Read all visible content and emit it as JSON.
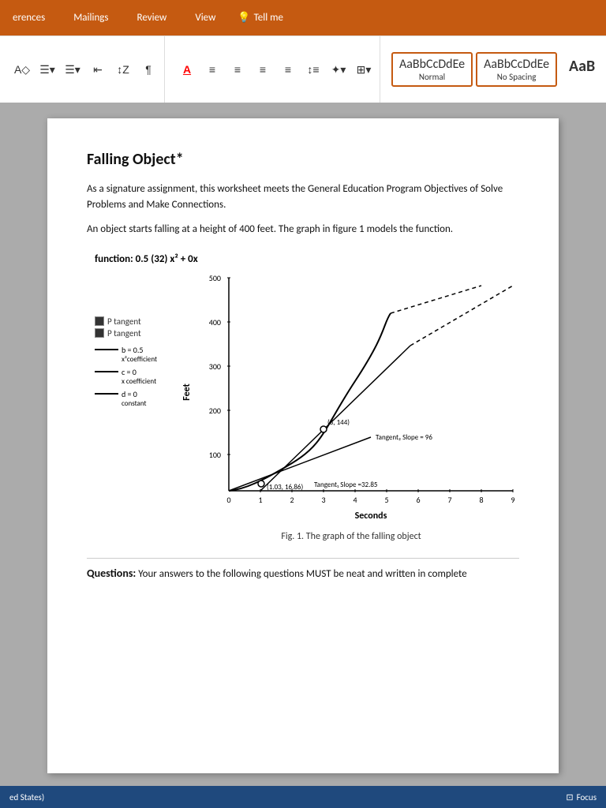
{
  "ribbon": {
    "tabs": [
      "erences",
      "Mailings",
      "Review",
      "View"
    ],
    "tell_me_label": "Tell me",
    "style_normal_label": "Normal",
    "style_nospacing_label": "No Spacing",
    "style_heading_label": "AaB",
    "style_preview_normal": "AaBbCcDdEe",
    "style_preview_nospacing": "AaBbCcDdEe"
  },
  "document": {
    "title": "Falling Object*",
    "intro_para": "As a signature assignment, this worksheet meets the General Education Program Objectives of Solve Problems and Make Connections.",
    "desc_para": "An object starts falling at a height of 400 feet. The graph in figure 1 models the function.",
    "function_label": "function: 0.5 (32) x² + 0x",
    "graph_y_label": "Feet",
    "graph_x_label": "Seconds",
    "graph_y_values": [
      "500",
      "400",
      "300",
      "200",
      "100"
    ],
    "graph_x_values": [
      "0",
      "1",
      "2",
      "3",
      "4",
      "5",
      "6",
      "7",
      "8",
      "9"
    ],
    "tangent1_label": "Tangent₁ Slope =32.85",
    "tangent2_label": "Tangent₂ Slope = 96",
    "point1_label": "(1.03, 16.86)",
    "point2_label": "(3, 144)",
    "b_coef": "b = 0.5",
    "b_label": "x²coefficient",
    "c_coef": "c = 0",
    "c_label": "x coefficient",
    "d_coef": "d = 0",
    "d_label": "constant",
    "tangent_p_label": "P tangent",
    "tangent_p2_label": "P tangent",
    "fig_caption": "Fig. 1. The graph of the falling object",
    "questions_label": "Questions:",
    "questions_text": "Your answers to the following questions MUST be neat and written in complete"
  },
  "status_bar": {
    "location": "ed States)",
    "focus_label": "Focus"
  }
}
